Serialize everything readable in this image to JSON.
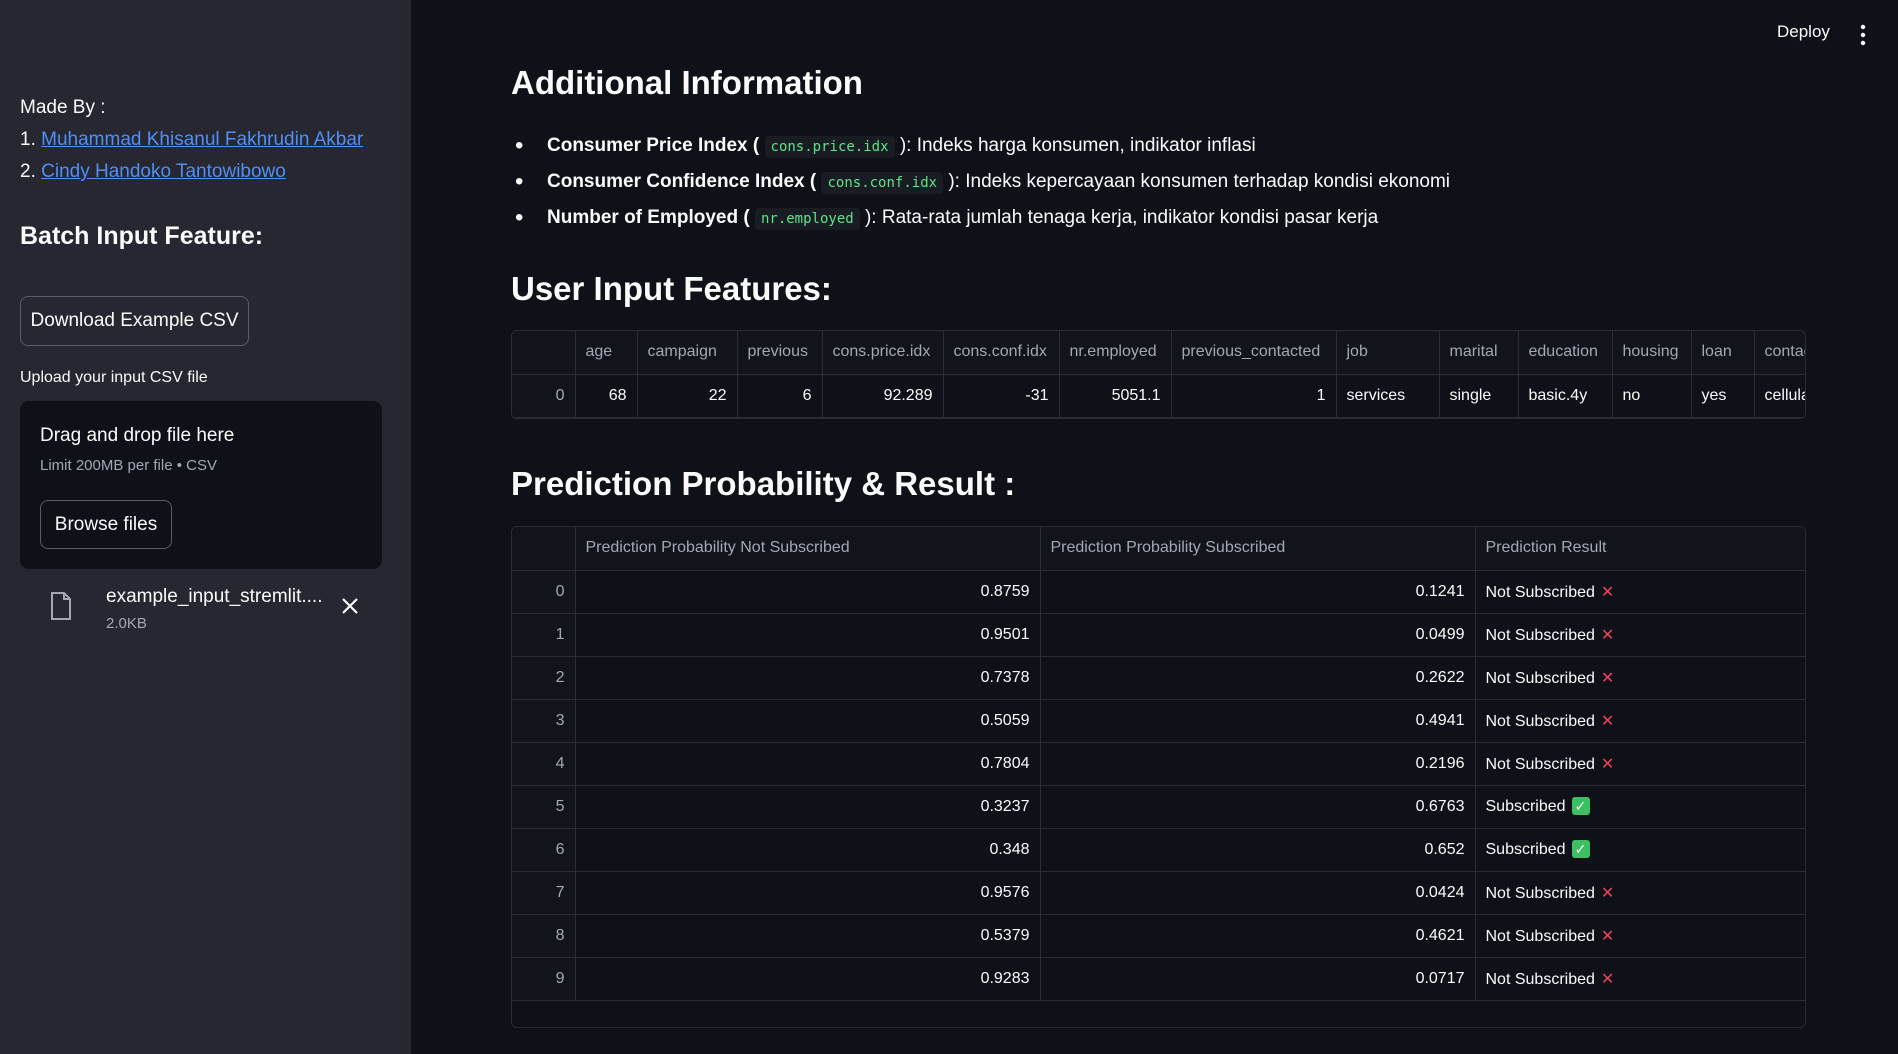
{
  "sidebar": {
    "made_by": "Made By :",
    "authors": [
      {
        "num": "1.",
        "name": "Muhammad Khisanul Fakhrudin Akbar"
      },
      {
        "num": "2.",
        "name": "Cindy Handoko Tantowibowo"
      }
    ],
    "batch_heading": "Batch Input Feature:",
    "download_button": "Download Example CSV",
    "upload_label": "Upload your input CSV file",
    "dropzone_title": "Drag and drop file here",
    "dropzone_limit": "Limit 200MB per file • CSV",
    "browse_button": "Browse files",
    "file_name": "example_input_stremlit....",
    "file_size": "2.0KB"
  },
  "header": {
    "deploy": "Deploy"
  },
  "main": {
    "additional_heading": "Additional Information",
    "bullets": [
      {
        "bold": "Consumer Price Index (",
        "code": "cons.price.idx",
        "rest": "): Indeks harga konsumen, indikator inflasi"
      },
      {
        "bold": "Consumer Confidence Index (",
        "code": "cons.conf.idx",
        "rest": "): Indeks kepercayaan konsumen terhadap kondisi ekonomi"
      },
      {
        "bold": "Number of Employed (",
        "code": "nr.employed",
        "rest": "): Rata-rata jumlah tenaga kerja, indikator kondisi pasar kerja"
      }
    ],
    "user_input_heading": "User Input Features:",
    "user_input_table": {
      "columns": [
        "",
        "age",
        "campaign",
        "previous",
        "cons.price.idx",
        "cons.conf.idx",
        "nr.employed",
        "previous_contacted",
        "job",
        "marital",
        "education",
        "housing",
        "loan",
        "contac"
      ],
      "row": [
        "0",
        "68",
        "22",
        "6",
        "92.289",
        "-31",
        "5051.1",
        "1",
        "services",
        "single",
        "basic.4y",
        "no",
        "yes",
        "cellula"
      ]
    },
    "prediction_heading": "Prediction Probability & Result :",
    "prediction_table": {
      "columns": [
        "",
        "Prediction Probability Not Subscribed",
        "Prediction Probability Subscribed",
        "Prediction Result"
      ],
      "rows": [
        [
          "0",
          "0.8759",
          "0.1241",
          "Not Subscribed",
          "x"
        ],
        [
          "1",
          "0.9501",
          "0.0499",
          "Not Subscribed",
          "x"
        ],
        [
          "2",
          "0.7378",
          "0.2622",
          "Not Subscribed",
          "x"
        ],
        [
          "3",
          "0.5059",
          "0.4941",
          "Not Subscribed",
          "x"
        ],
        [
          "4",
          "0.7804",
          "0.2196",
          "Not Subscribed",
          "x"
        ],
        [
          "5",
          "0.3237",
          "0.6763",
          "Subscribed",
          "check"
        ],
        [
          "6",
          "0.348",
          "0.652",
          "Subscribed",
          "check"
        ],
        [
          "7",
          "0.9576",
          "0.0424",
          "Not Subscribed",
          "x"
        ],
        [
          "8",
          "0.5379",
          "0.4621",
          "Not Subscribed",
          "x"
        ],
        [
          "9",
          "0.9283",
          "0.0717",
          "Not Subscribed",
          "x"
        ]
      ]
    }
  },
  "colors": {
    "accent_link": "#4f8ff7",
    "x_mark": "#f0415b",
    "check_mark": "#3cc063",
    "code_text": "#5ce488"
  }
}
